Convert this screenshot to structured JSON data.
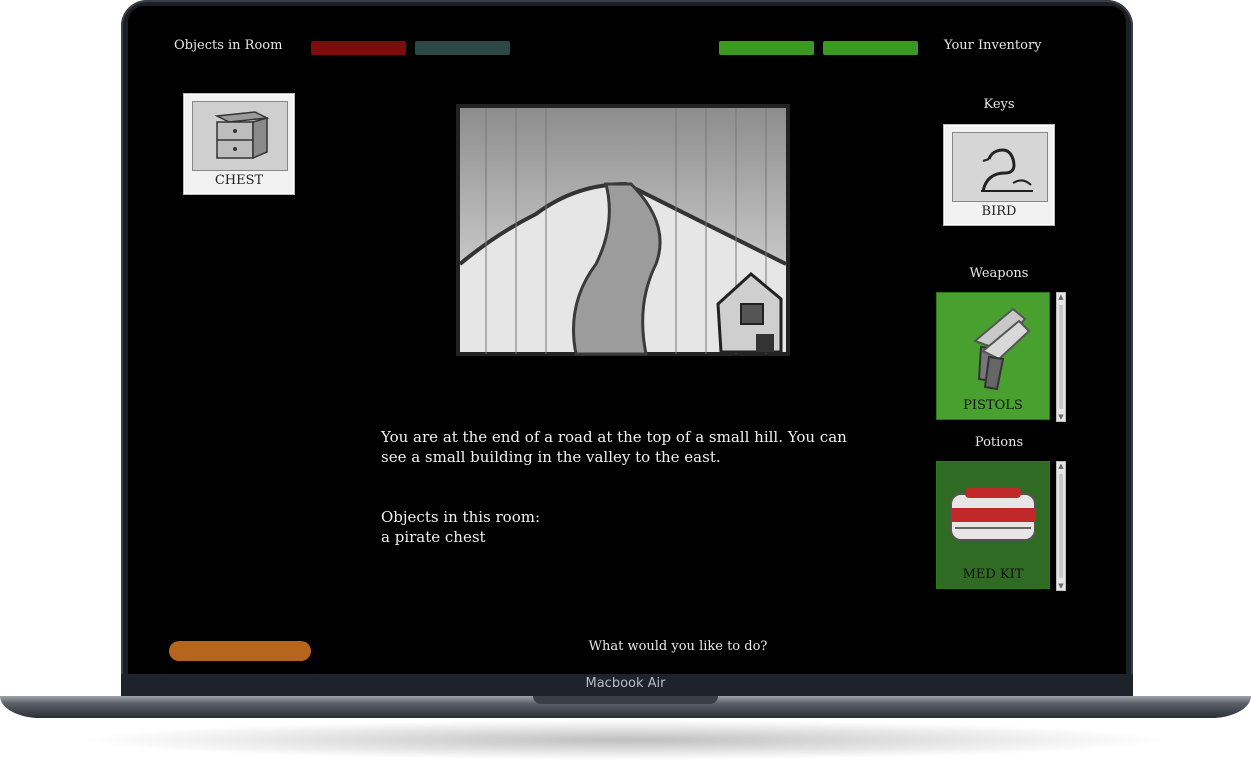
{
  "device": {
    "label": "Macbook Air"
  },
  "header": {
    "objects_title": "Objects in Room",
    "inventory_title": "Your Inventory"
  },
  "colors": {
    "bar_red": "#7d0c0c",
    "bar_slate": "#2c4746",
    "bar_green": "#3a9a20",
    "weapon_tile": "#48a02e",
    "potion_tile": "#2f6b22",
    "action_button": "#b5651d"
  },
  "room_objects": [
    {
      "label": "CHEST",
      "icon": "chest-icon"
    }
  ],
  "inventory": {
    "keys": {
      "title": "Keys",
      "items": [
        {
          "label": "BIRD",
          "icon": "bird-icon"
        }
      ]
    },
    "weapons": {
      "title": "Weapons",
      "items": [
        {
          "label": "PISTOLS",
          "icon": "pistol-icon"
        }
      ]
    },
    "potions": {
      "title": "Potions",
      "items": [
        {
          "label": "MED KIT",
          "icon": "medkit-icon"
        }
      ]
    }
  },
  "scene": {
    "image": "road-hill-sketch",
    "description": "You are at the end of a road at the top of a small hill. You can see a small building in the valley to the east.",
    "objects_heading": "Objects in this room:",
    "objects_list": "a pirate chest"
  },
  "prompt": {
    "text": "What would you like to do?"
  }
}
